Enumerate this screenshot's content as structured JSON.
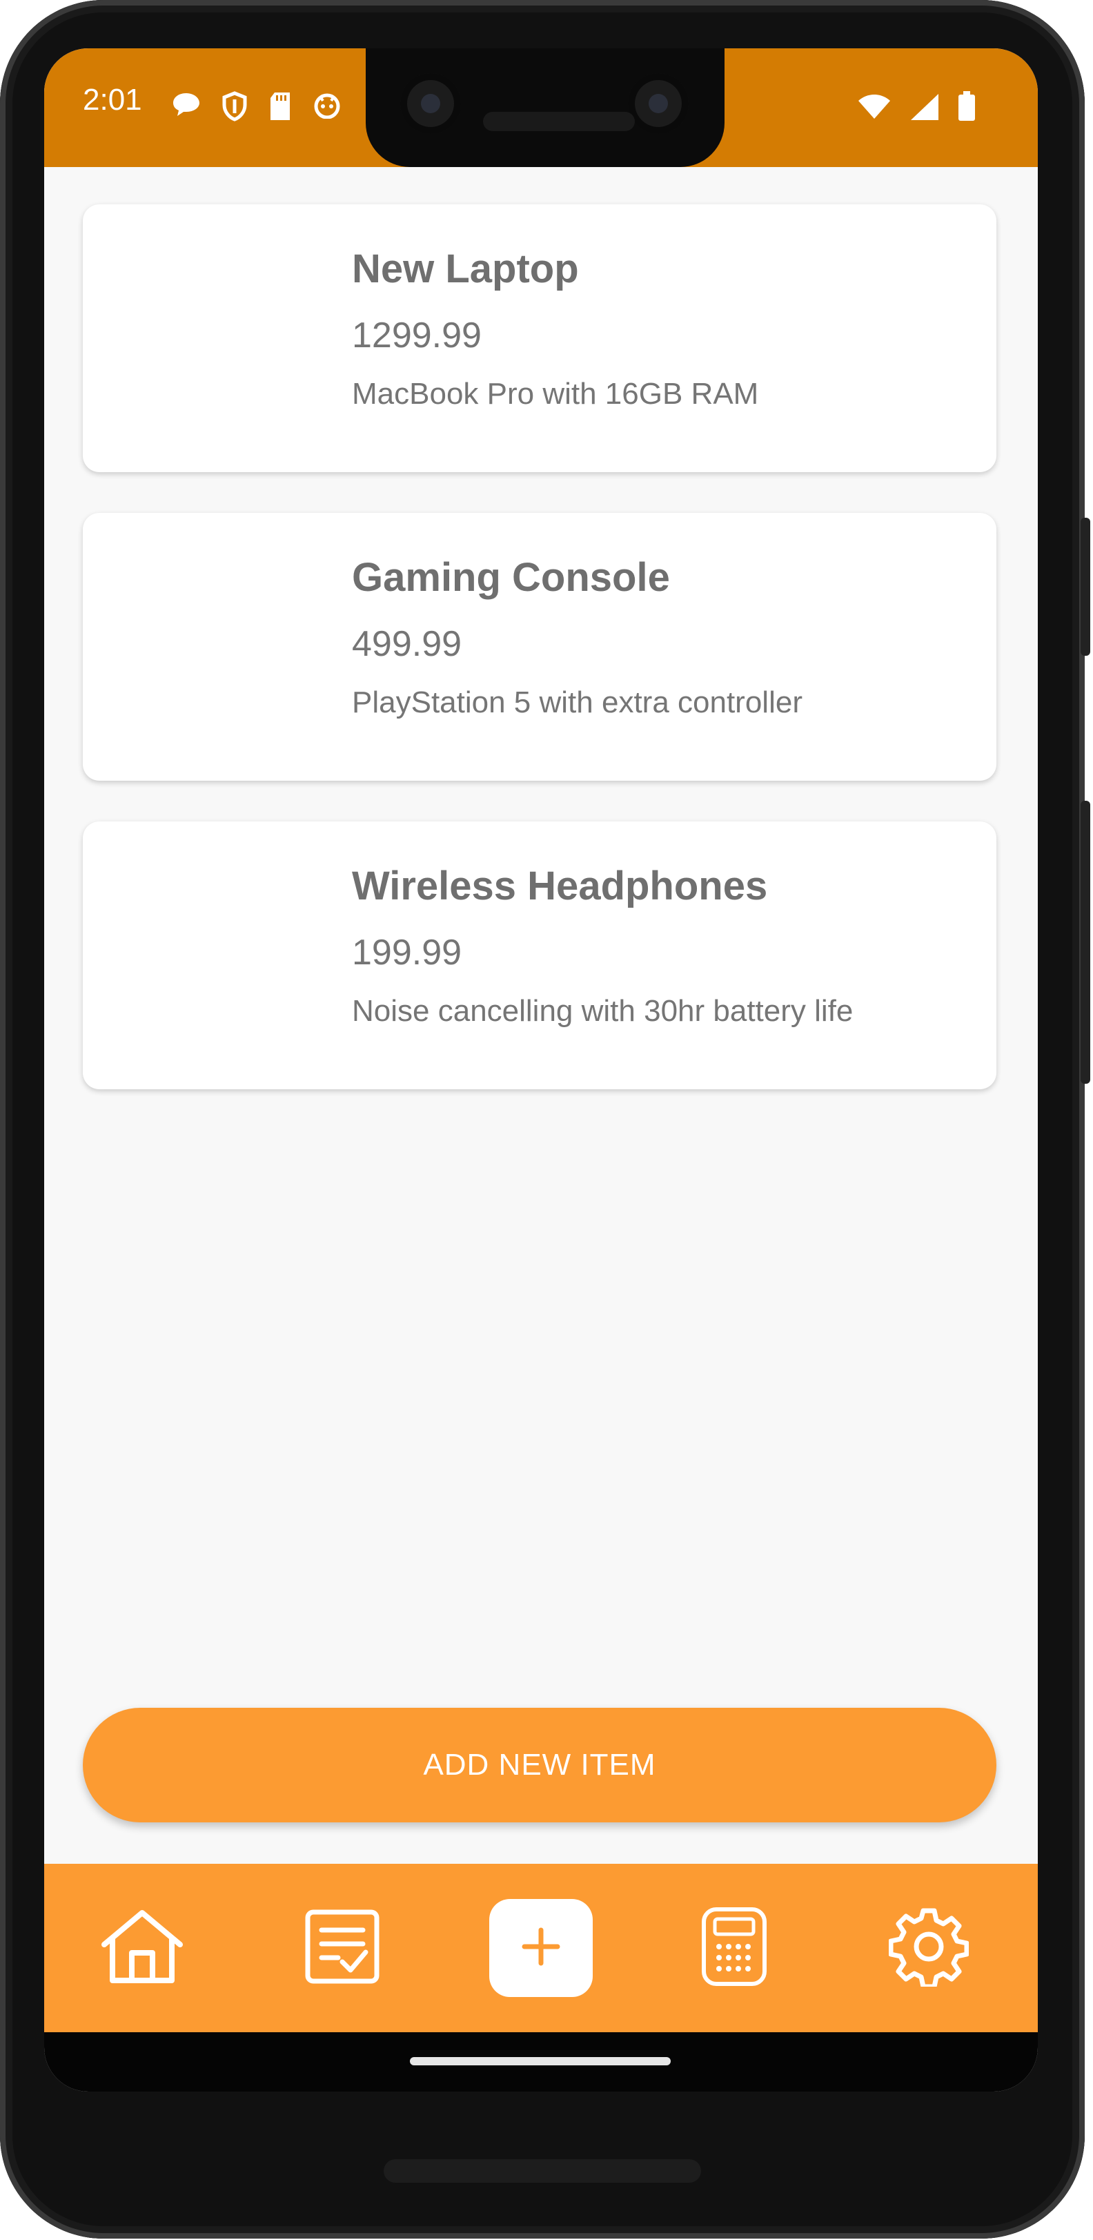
{
  "status_bar": {
    "time": "2:01",
    "left_icons": [
      "chat-bubble-icon",
      "shield-icon",
      "sd-card-icon",
      "android-icon"
    ],
    "right_icons": [
      "wifi-icon",
      "signal-icon",
      "battery-icon"
    ]
  },
  "items": [
    {
      "title": "New Laptop",
      "price": "1299.99",
      "description": "MacBook Pro with 16GB RAM"
    },
    {
      "title": "Gaming Console",
      "price": "499.99",
      "description": "PlayStation 5 with extra controller"
    },
    {
      "title": "Wireless Headphones",
      "price": "199.99",
      "description": "Noise cancelling with 30hr battery life"
    }
  ],
  "add_button": {
    "label": "ADD NEW ITEM"
  },
  "bottom_nav": {
    "items": [
      "home-icon",
      "checklist-icon",
      "plus-icon",
      "calculator-icon",
      "gear-icon"
    ]
  },
  "colors": {
    "status_bar": "#d47c03",
    "accent": "#fc9b32",
    "background": "#f8f8f8",
    "card_text": "#757575"
  }
}
